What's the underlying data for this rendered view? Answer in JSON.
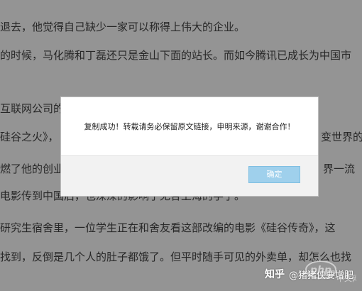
{
  "article": {
    "lines": [
      "退去，他觉得自己缺少一家可以称得上伟大的企业。",
      "的时候，马化腾和丁磊还只是金山下面的站长。而如今腾讯已成长为中国市",
      "互联网公司的",
      "硅谷之火》，",
      "燃了他的创业",
      "电影传到中国后，也深深的影响了无各上海的学子。",
      "研究生宿舍里，一位学生正在和舍友看这部改编的电影《硅谷传奇》，这",
      "找到，反倒是几个人的肚子都饿了。但平时随手可见的外卖单，却怎么也找"
    ],
    "right_fragments": [
      "变世界的",
      "界一流"
    ]
  },
  "dialog": {
    "message": "复制成功！转载请务必保留原文链接，申明来源，谢谢合作！",
    "confirm_label": "确定"
  },
  "watermark": {
    "brand": "知乎",
    "author": "@猪猪侠要增肥",
    "logo_text": "php",
    "logo_subtext": "中文网"
  }
}
